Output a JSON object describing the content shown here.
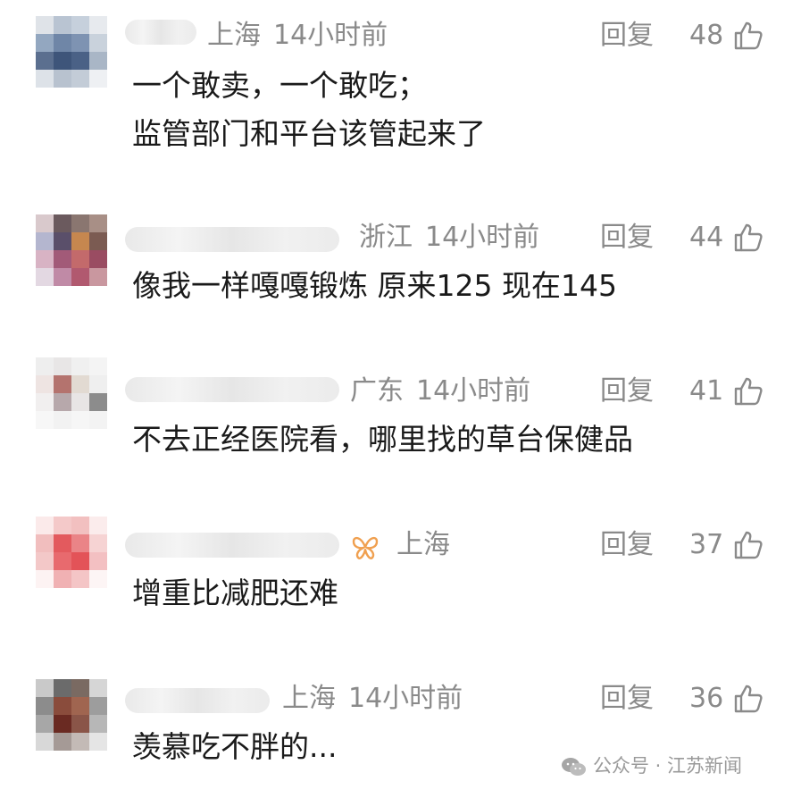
{
  "comments": [
    {
      "location": "上海",
      "time": "14小时前",
      "reply_label": "回复",
      "likes": "48",
      "text_lines": [
        "一个敢卖，一个敢吃；",
        "监管部门和平台该管起来了"
      ]
    },
    {
      "location": "浙江",
      "time": "14小时前",
      "reply_label": "回复",
      "likes": "44",
      "text_lines": [
        "像我一样嘎嘎锻炼 原来125 现在145"
      ]
    },
    {
      "location": "广东",
      "time": "14小时前",
      "reply_label": "回复",
      "likes": "41",
      "text_lines": [
        "不去正经医院看，哪里找的草台保健品"
      ]
    },
    {
      "location": "上海",
      "reply_label": "回复",
      "likes": "37",
      "text_lines": [
        "增重比减肥还难"
      ]
    },
    {
      "location": "上海",
      "time": "14小时前",
      "reply_label": "回复",
      "likes": "36",
      "text_lines": [
        "羡慕吃不胖的..."
      ]
    }
  ],
  "watermark": {
    "text": "公众号 · 江苏新闻"
  },
  "colors": {
    "meta": "#8a8a8a",
    "text": "#1a1a1a",
    "badge": "#f0a050"
  },
  "icons": {
    "like": "thumbs-up-icon",
    "badge": "butterfly-badge-icon",
    "watermark": "wechat-icon"
  }
}
